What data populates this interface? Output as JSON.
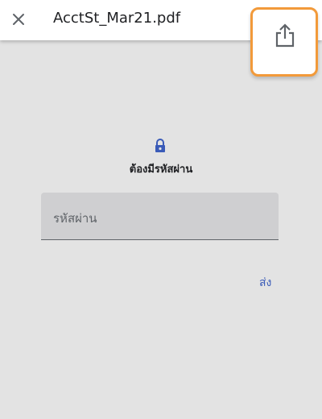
{
  "toolbar": {
    "file_title": "AcctSt_Mar21.pdf",
    "close_icon": "close-icon",
    "share_icon": "share-icon"
  },
  "password_prompt": {
    "lock_icon": "lock-icon",
    "message": "ต้องมีรหัสผ่าน",
    "input_placeholder": "รหัสผ่าน",
    "input_value": "",
    "submit_label": "ส่ง"
  },
  "colors": {
    "background": "#e3e3e3",
    "toolbar": "#ffffff",
    "accent": "#3a5bb8",
    "highlight": "#f29a3a",
    "field": "#cfcfd1"
  }
}
